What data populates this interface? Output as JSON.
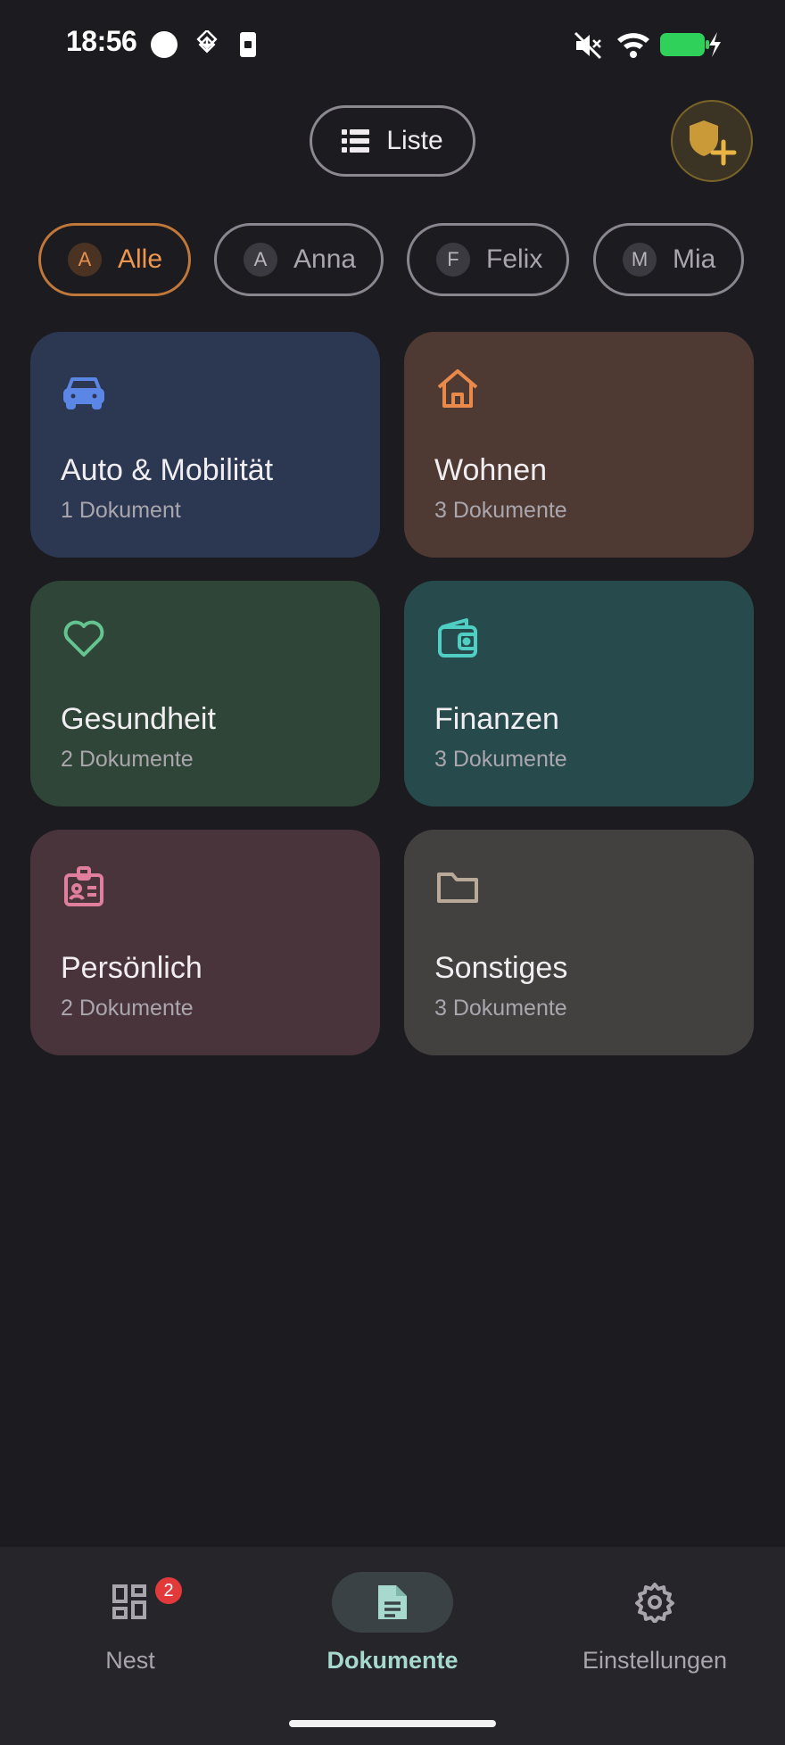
{
  "status_bar": {
    "time": "18:56"
  },
  "top": {
    "view_toggle_label": "Liste"
  },
  "filters": [
    {
      "initial": "A",
      "name": "Alle",
      "selected": true
    },
    {
      "initial": "A",
      "name": "Anna",
      "selected": false
    },
    {
      "initial": "F",
      "name": "Felix",
      "selected": false
    },
    {
      "initial": "M",
      "name": "Mia",
      "selected": false
    }
  ],
  "categories": [
    {
      "title": "Auto & Mobilität",
      "count": "1 Dokument",
      "icon": "car-icon",
      "color": "#2c3852",
      "accent": "#5b86e5"
    },
    {
      "title": "Wohnen",
      "count": "3 Dokumente",
      "icon": "house-icon",
      "color": "#4e3a33",
      "accent": "#ea8a4a"
    },
    {
      "title": "Gesundheit",
      "count": "2 Dokumente",
      "icon": "heart-icon",
      "color": "#2f4537",
      "accent": "#63c48f"
    },
    {
      "title": "Finanzen",
      "count": "3 Dokumente",
      "icon": "wallet-icon",
      "color": "#274a4c",
      "accent": "#4fcfc4"
    },
    {
      "title": "Persönlich",
      "count": "2 Dokumente",
      "icon": "id-badge-icon",
      "color": "#4a343b",
      "accent": "#e07f9d"
    },
    {
      "title": "Sonstiges",
      "count": "3 Dokumente",
      "icon": "folder-icon",
      "color": "#434040",
      "accent": "#b8a998"
    }
  ],
  "bottom_nav": {
    "items": [
      {
        "label": "Nest",
        "icon": "dashboard-icon",
        "badge": "2",
        "active": false
      },
      {
        "label": "Dokumente",
        "icon": "document-icon",
        "active": true
      },
      {
        "label": "Einstellungen",
        "icon": "gear-icon",
        "active": false
      }
    ]
  }
}
